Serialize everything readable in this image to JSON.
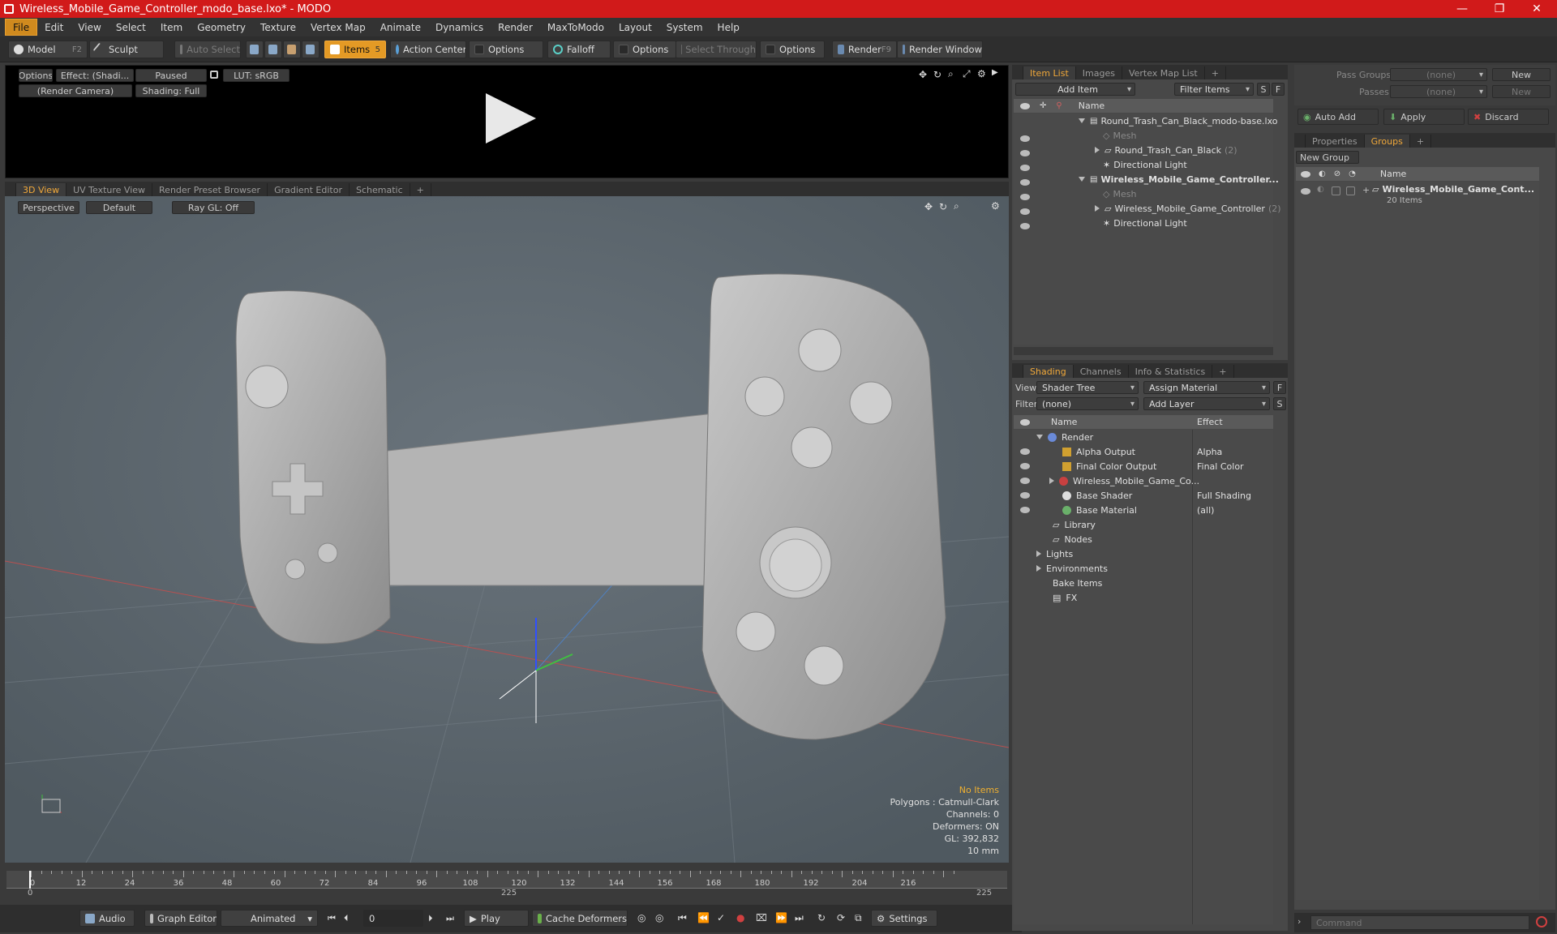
{
  "window": {
    "title": "Wireless_Mobile_Game_Controller_modo_base.lxo* - MODO",
    "minimize": "—",
    "maximize": "❐",
    "close": "✕"
  },
  "menu": [
    "File",
    "Edit",
    "View",
    "Select",
    "Item",
    "Geometry",
    "Texture",
    "Vertex Map",
    "Animate",
    "Dynamics",
    "Render",
    "MaxToModo",
    "Layout",
    "System",
    "Help"
  ],
  "toolbar": {
    "model": "Model",
    "model_key": "F2",
    "sculpt": "Sculpt",
    "auto_select": "Auto Select",
    "items": "Items",
    "items_key": "5",
    "action_center": "Action Center",
    "options1": "Options",
    "falloff": "Falloff",
    "options2": "Options",
    "select_through": "Select Through",
    "options3": "Options",
    "render": "Render",
    "render_key": "F9",
    "render_window": "Render Window"
  },
  "preview": {
    "options": "Options",
    "effect": "Effect: (Shadi...",
    "paused": "Paused",
    "lut": "LUT: sRGB",
    "camera": "(Render Camera)",
    "shading": "Shading: Full"
  },
  "viewport_tabs": [
    "3D View",
    "UV Texture View",
    "Render Preset Browser",
    "Gradient Editor",
    "Schematic",
    "+"
  ],
  "viewport": {
    "perspective": "Perspective",
    "default": "Default",
    "raygl": "Ray GL: Off",
    "info": {
      "no_items": "No Items",
      "polygons": "Polygons : Catmull-Clark",
      "channels": "Channels: 0",
      "deformers": "Deformers: ON",
      "gl": "GL: 392,832",
      "scale": "10 mm"
    }
  },
  "timeline": {
    "ticks": [
      "0",
      "12",
      "24",
      "36",
      "48",
      "60",
      "72",
      "84",
      "96",
      "108",
      "120",
      "132",
      "144",
      "156",
      "168",
      "180",
      "192",
      "204",
      "216"
    ],
    "start": "0",
    "mid": "225",
    "end": "225"
  },
  "bottom": {
    "audio": "Audio",
    "graph_editor": "Graph Editor",
    "animated": "Animated",
    "frame": "0",
    "play": "Play",
    "cache": "Cache Deformers",
    "settings": "Settings"
  },
  "item_list": {
    "tabs": [
      "Item List",
      "Images",
      "Vertex Map List",
      "+"
    ],
    "add_item": "Add Item",
    "filter": "Filter Items",
    "s": "S",
    "f": "F",
    "col_name": "Name",
    "rows": [
      {
        "label": "Round_Trash_Can_Black_modo-base.lxo",
        "count": ""
      },
      {
        "label": "Mesh",
        "count": ""
      },
      {
        "label": "Round_Trash_Can_Black",
        "count": "(2)"
      },
      {
        "label": "Directional Light",
        "count": ""
      },
      {
        "label": "Wireless_Mobile_Game_Controller...",
        "count": ""
      },
      {
        "label": "Mesh",
        "count": ""
      },
      {
        "label": "Wireless_Mobile_Game_Controller",
        "count": "(2)"
      },
      {
        "label": "Directional Light",
        "count": ""
      }
    ]
  },
  "shading": {
    "tabs": [
      "Shading",
      "Channels",
      "Info & Statistics",
      "+"
    ],
    "view_label": "View",
    "view_value": "Shader Tree",
    "assign": "Assign Material",
    "f": "F",
    "filter_label": "Filter",
    "filter_value": "(none)",
    "add_layer": "Add Layer",
    "s": "S",
    "col_name": "Name",
    "col_effect": "Effect",
    "rows": [
      {
        "label": "Render",
        "effect": ""
      },
      {
        "label": "Alpha Output",
        "effect": "Alpha"
      },
      {
        "label": "Final Color Output",
        "effect": "Final Color"
      },
      {
        "label": "Wireless_Mobile_Game_Co...",
        "effect": ""
      },
      {
        "label": "Base Shader",
        "effect": "Full Shading"
      },
      {
        "label": "Base Material",
        "effect": "(all)"
      },
      {
        "label": "Library",
        "effect": ""
      },
      {
        "label": "Nodes",
        "effect": ""
      },
      {
        "label": "Lights",
        "effect": ""
      },
      {
        "label": "Environments",
        "effect": ""
      },
      {
        "label": "Bake Items",
        "effect": ""
      },
      {
        "label": "FX",
        "effect": ""
      }
    ]
  },
  "right": {
    "pass_groups": "Pass Groups",
    "pass_value": "(none)",
    "new": "New",
    "passes": "Passes",
    "passes_value": "(none)",
    "new2": "New",
    "auto_add": "Auto Add",
    "apply": "Apply",
    "discard": "Discard",
    "tabs": [
      "Properties",
      "Groups",
      "+"
    ],
    "new_group": "New Group",
    "col_name": "Name",
    "group_name": "Wireless_Mobile_Game_Cont...",
    "group_count": "20 Items"
  },
  "command": {
    "placeholder": "Command"
  }
}
